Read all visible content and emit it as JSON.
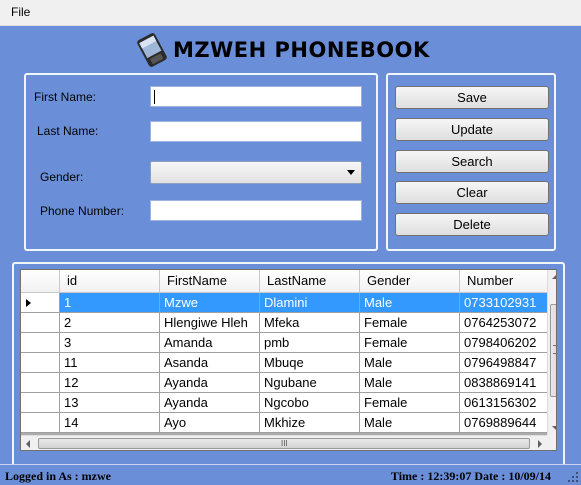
{
  "menu": {
    "file": "File"
  },
  "header": {
    "title": "MZWEH PHONEBOOK",
    "icon": "mobile-phone-icon"
  },
  "form": {
    "first_name_label": "First Name:",
    "last_name_label": "Last Name:",
    "gender_label": "Gender:",
    "phone_label": "Phone Number:",
    "first_name_value": "",
    "last_name_value": "",
    "gender_value": "",
    "phone_value": ""
  },
  "buttons": {
    "save": "Save",
    "update": "Update",
    "search": "Search",
    "clear": "Clear",
    "delete": "Delete"
  },
  "grid": {
    "columns": [
      "id",
      "FirstName",
      "LastName",
      "Gender",
      "Number"
    ],
    "rows": [
      [
        "1",
        "Mzwe",
        "Dlamini",
        "Male",
        "0733102931"
      ],
      [
        "2",
        "Hlengiwe Hleh",
        "Mfeka",
        "Female",
        "0764253072"
      ],
      [
        "3",
        "Amanda",
        "pmb",
        "Female",
        "0798406202"
      ],
      [
        "11",
        "Asanda",
        "Mbuqe",
        "Male",
        "0796498847"
      ],
      [
        "12",
        "Ayanda",
        "Ngubane",
        "Male",
        "0838869141"
      ],
      [
        "13",
        "Ayanda",
        "Ngcobo",
        "Female",
        "0613156302"
      ],
      [
        "14",
        "Ayo",
        "Mkhize",
        "Male",
        "0769889644"
      ]
    ],
    "selected_row": 0,
    "scroll_grip": "III"
  },
  "status": {
    "logged_in": "Logged in As :    mzwe",
    "time_date": "Time : 12:39:07  Date : 10/09/14"
  },
  "colors": {
    "background": "#6a8fd8",
    "selection": "#3399ff"
  }
}
